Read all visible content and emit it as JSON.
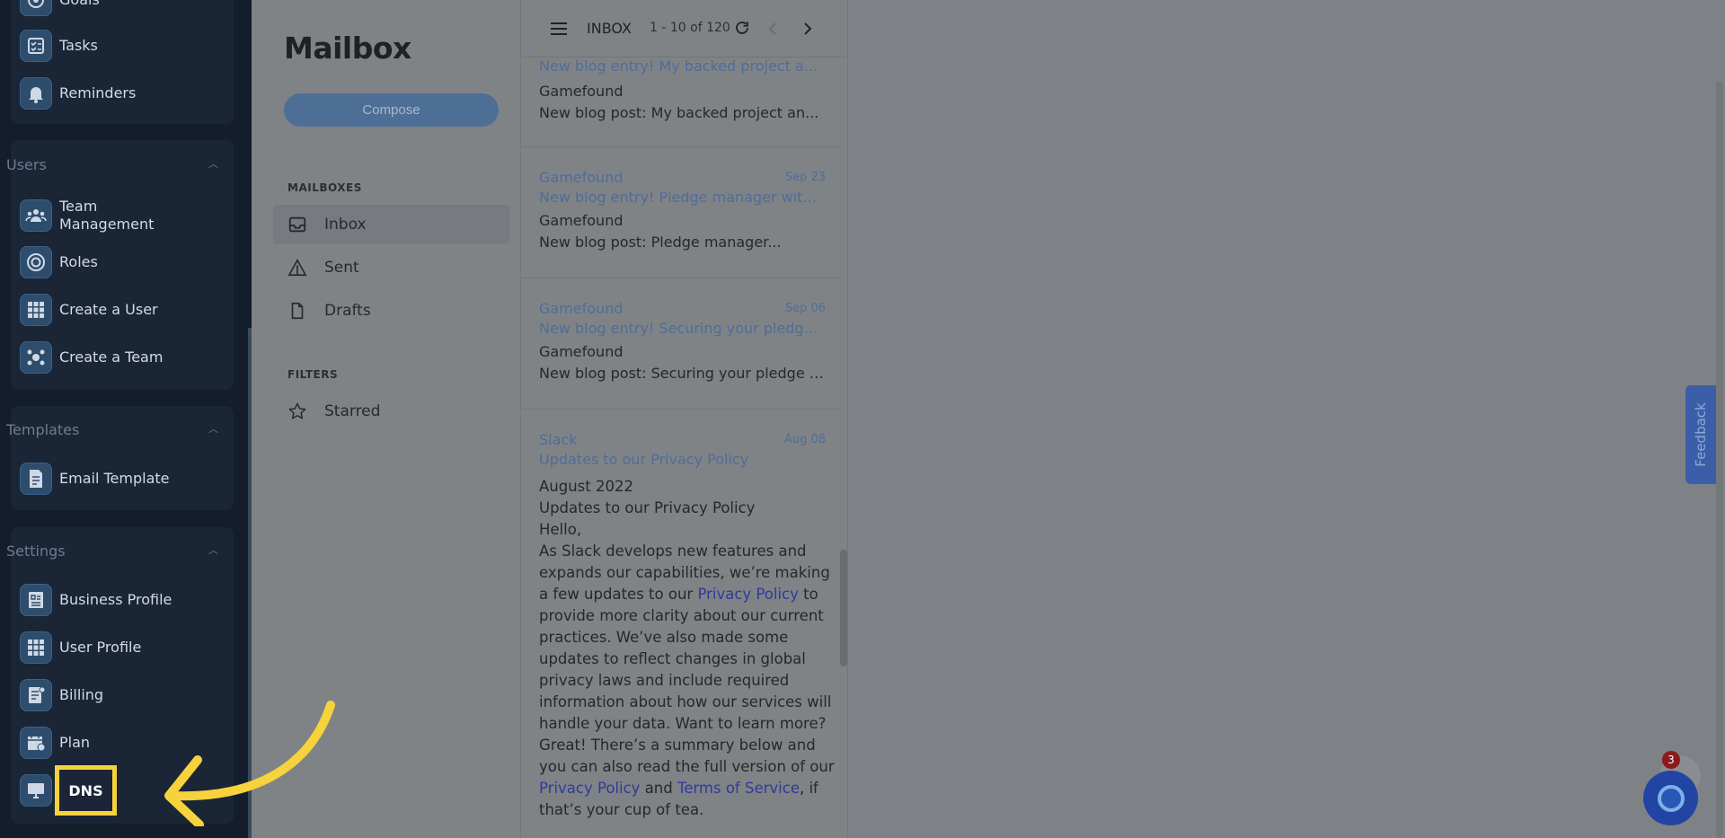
{
  "sidebar": {
    "partial_top_label": "Goals",
    "group1": {
      "items": [
        {
          "label": "Tasks",
          "icon": "tasks-icon"
        },
        {
          "label": "Reminders",
          "icon": "bell-icon"
        }
      ]
    },
    "users": {
      "heading": "Users",
      "items": [
        {
          "label": "Team Management",
          "icon": "team-icon"
        },
        {
          "label": "Roles",
          "icon": "roles-icon"
        },
        {
          "label": "Create a User",
          "icon": "grid-icon"
        },
        {
          "label": "Create a Team",
          "icon": "create-team-icon"
        }
      ]
    },
    "templates": {
      "heading": "Templates",
      "items": [
        {
          "label": "Email Template",
          "icon": "document-icon"
        }
      ]
    },
    "settings": {
      "heading": "Settings",
      "items": [
        {
          "label": "Business Profile",
          "icon": "business-profile-icon"
        },
        {
          "label": "User Profile",
          "icon": "grid-icon"
        },
        {
          "label": "Billing",
          "icon": "billing-icon"
        },
        {
          "label": "Plan",
          "icon": "plan-icon"
        },
        {
          "label": "DNS",
          "icon": "dns-icon"
        }
      ]
    }
  },
  "mailbox": {
    "title": "Mailbox",
    "compose_label": "Compose",
    "mailboxes_heading": "MAILBOXES",
    "nav": [
      {
        "label": "Inbox",
        "active": true
      },
      {
        "label": "Sent"
      },
      {
        "label": "Drafts"
      }
    ],
    "filters_heading": "FILTERS",
    "filters": [
      {
        "label": "Starred"
      }
    ]
  },
  "list": {
    "folder": "INBOX",
    "count": "1 - 10 of 120",
    "messages": [
      {
        "subject": "New blog entry! My backed project a...",
        "sender": "Gamefound",
        "snippet": "New blog post: My backed project an..."
      },
      {
        "from": "Gamefound",
        "date": "Sep 23",
        "subject": "New blog entry! Pledge manager with...",
        "sender": "Gamefound",
        "snippet": "New blog post: Pledge manager..."
      },
      {
        "from": "Gamefound",
        "date": "Sep 06",
        "subject": "New blog entry! Securing your pledge...",
        "sender": "Gamefound",
        "snippet": "New blog post: Securing your pledge i..."
      },
      {
        "from": "Slack",
        "date": "Aug 08",
        "subject": "Updates to our Privacy Policy"
      }
    ],
    "body": {
      "line1": "August 2022",
      "line2": "Updates to our Privacy Policy",
      "line3": "Hello,",
      "p1": "As Slack develops new features and expands our capabilities, we’re making a few updates to our ",
      "link1": "Privacy Policy",
      "p2": " to provide more clarity about our current practices. We’ve also made some updates to reflect changes in global privacy laws and include required information about how our services will handle your data. Want to learn more? Great! There’s a summary below and you can also read the full version of our ",
      "link2": "Privacy Policy",
      "p3": " and ",
      "link3": "Terms of Service",
      "p4": ", if that’s your cup of tea."
    }
  },
  "widgets": {
    "feedback_label": "Feedback",
    "chat_badge": "3"
  },
  "annotation": {
    "highlight_label": "DNS",
    "highlight_color": "#f6d23c"
  }
}
